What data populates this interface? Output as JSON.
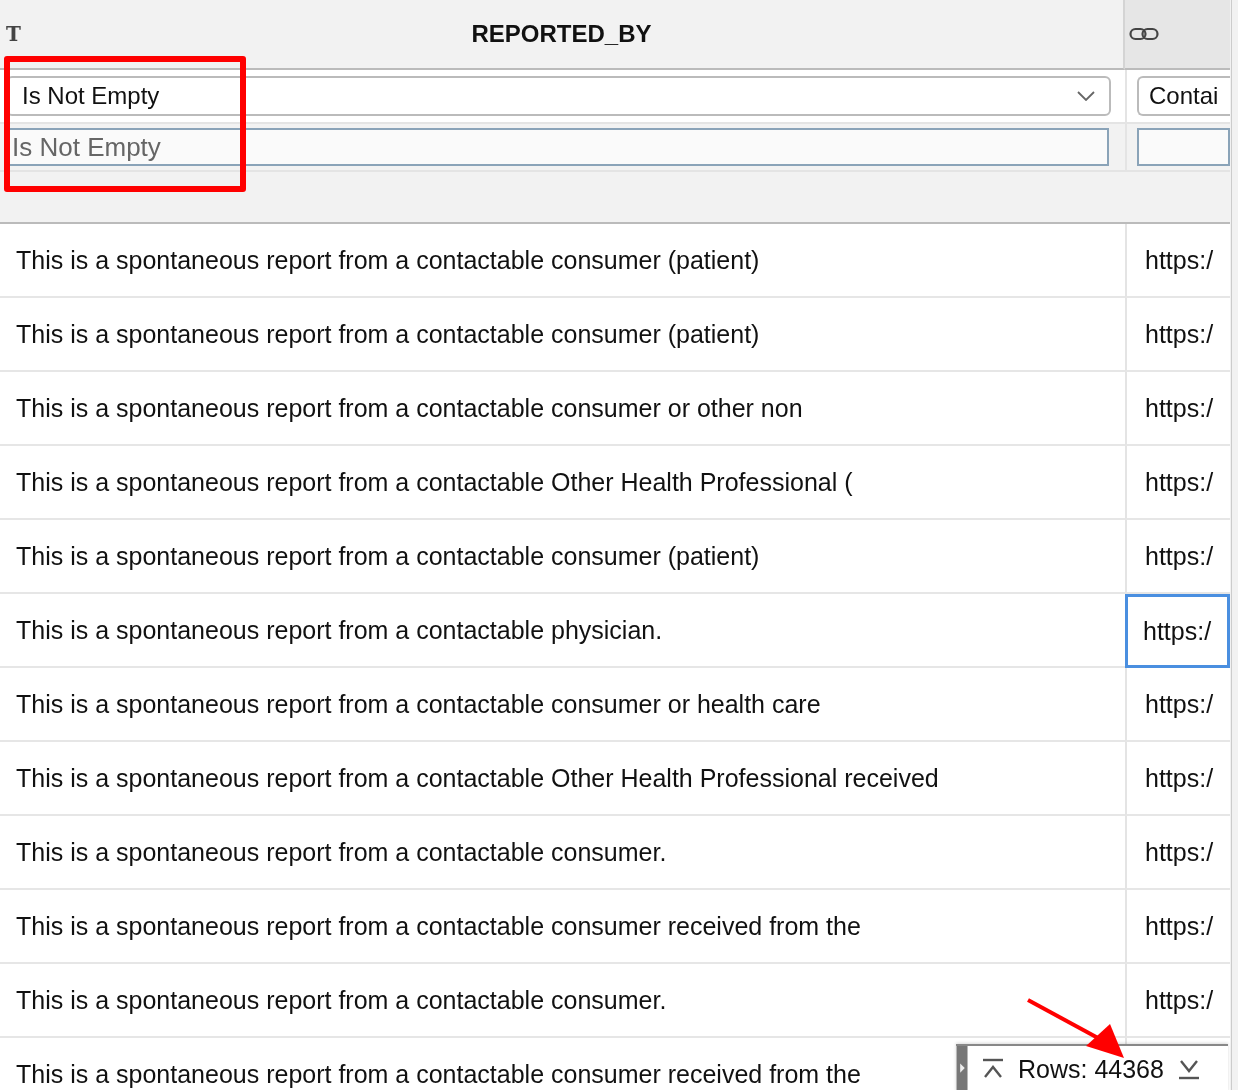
{
  "columns": [
    {
      "type_icon": "T",
      "header": "REPORTED_BY",
      "filter_operator": "Is Not Empty",
      "filter_placeholder": "Is Not Empty"
    },
    {
      "filter_operator": "Contai"
    }
  ],
  "rows": [
    {
      "reported_by": "This is a spontaneous report from a contactable consumer (patient)",
      "link": "https:/",
      "focused": false
    },
    {
      "reported_by": "This is a spontaneous report from a contactable consumer (patient)",
      "link": "https:/",
      "focused": false
    },
    {
      "reported_by": "This is a spontaneous report from a contactable consumer or other non",
      "link": "https:/",
      "focused": false
    },
    {
      "reported_by": "This is a spontaneous report from a contactable Other Health Professional (",
      "link": "https:/",
      "focused": false
    },
    {
      "reported_by": "This is a spontaneous report from a contactable consumer (patient)",
      "link": "https:/",
      "focused": false
    },
    {
      "reported_by": "This is a spontaneous report from a contactable physician.",
      "link": "https:/",
      "focused": true
    },
    {
      "reported_by": "This is a spontaneous report from a contactable consumer or health care",
      "link": "https:/",
      "focused": false
    },
    {
      "reported_by": "This is a spontaneous report from a contactable Other Health Professional received",
      "link": "https:/",
      "focused": false
    },
    {
      "reported_by": "This is a spontaneous report from a contactable consumer.",
      "link": "https:/",
      "focused": false
    },
    {
      "reported_by": "This is a spontaneous report from a contactable consumer received from the",
      "link": "https:/",
      "focused": false
    },
    {
      "reported_by": "This is a spontaneous report from a contactable consumer.",
      "link": "https:/",
      "focused": false
    },
    {
      "reported_by": "This is a spontaneous report from a contactable consumer received from the",
      "link": "",
      "focused": false
    }
  ],
  "footer": {
    "row_count": "Rows: 44368"
  }
}
